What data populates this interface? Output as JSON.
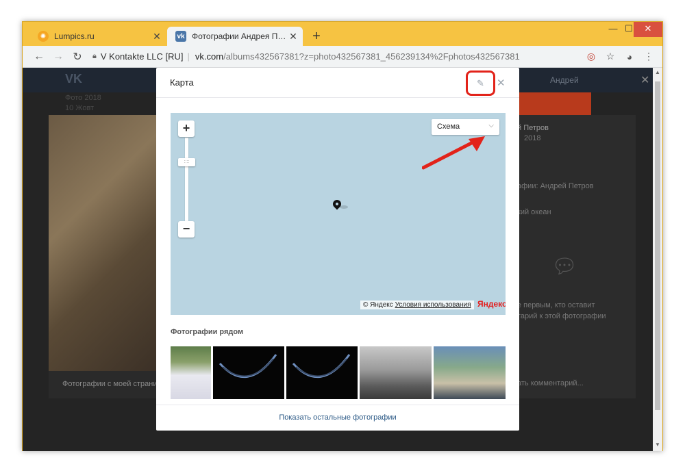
{
  "tabs": [
    {
      "title": "Lumpics.ru",
      "favicon_color": "#f5a623"
    },
    {
      "title": "Фотографии Андрея Петрова –",
      "favicon_color": "#4a76a8"
    }
  ],
  "toolbar": {
    "org": "V Kontakte LLC [RU]",
    "host": "vk.com",
    "path": "/albums432567381?z=photo432567381_456239134%2Fphotos432567381"
  },
  "background": {
    "vk_logo": "VK",
    "user_name": "Андрей",
    "left_text_1": "Фото 2018",
    "left_text_2": "10 Жовт",
    "photo_caption": "Фотографии с моей страни",
    "owner_name": "й Петров",
    "owner_date": "2018",
    "tag_text": "афии: Андрей Петров",
    "place_text": "кий океан",
    "comment_1": "е первым, кто оставит",
    "comment_2": "тарий к этой фотографии",
    "write_comment": "ать комментарий..."
  },
  "modal": {
    "title": "Карта",
    "scheme_label": "Схема",
    "attribution": "© Яндекс",
    "terms_link": "Условия использования",
    "yandex_logo": "Яндекс",
    "nearby_title": "Фотографии рядом",
    "show_more": "Показать остальные фотографии"
  },
  "colors": {
    "accent_red": "#e2231a",
    "map_water": "#b9d4e1",
    "vk_link": "#2a5885"
  }
}
